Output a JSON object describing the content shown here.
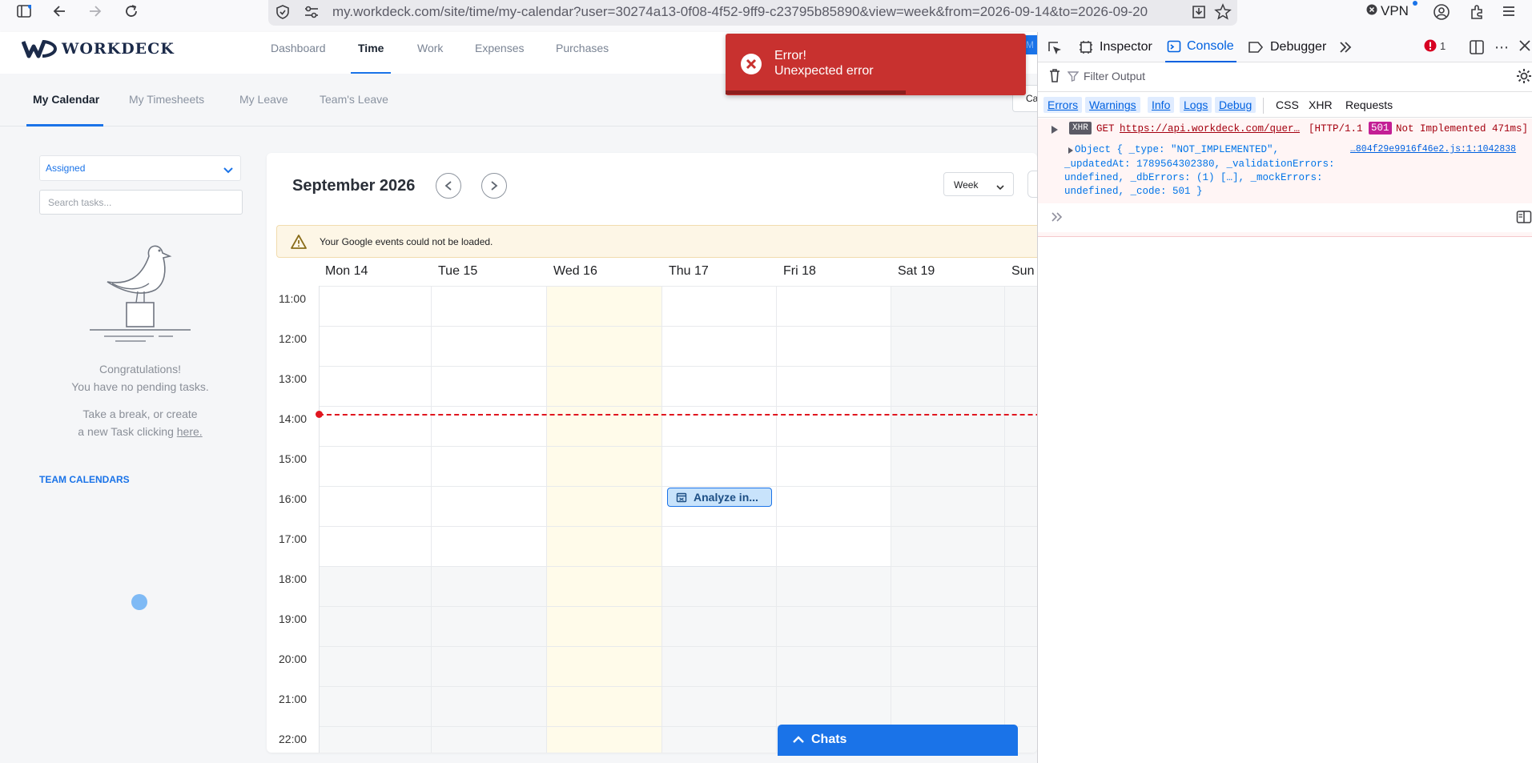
{
  "browser": {
    "url": "my.workdeck.com/site/time/my-calendar?user=30274a13-0f08-4f52-9ff9-c23795b85890&view=week&from=2026-09-14&to=2026-09-20",
    "vpn_label": "VPN"
  },
  "app": {
    "logo_text": "WORKDECK",
    "nav": [
      "Dashboard",
      "Time",
      "Work",
      "Expenses",
      "Purchases"
    ],
    "active_nav": "Time",
    "subtabs": [
      "My Calendar",
      "My Timesheets",
      "My Leave",
      "Team's Leave"
    ],
    "active_subtab": "My Calendar",
    "partial_button_text": "Ca",
    "partial_avatar_text": "M"
  },
  "sidebar": {
    "filter_value": "Assigned",
    "search_placeholder": "Search tasks...",
    "empty_line1": "Congratulations!",
    "empty_line2": "You have no pending tasks.",
    "empty_line3": "Take a break, or create",
    "empty_line4": "a new Task clicking",
    "empty_link": "here.",
    "team_calendars": "TEAM CALENDARS"
  },
  "calendar": {
    "month_title": "September 2026",
    "view": "Week",
    "warning": "Your Google events could not be loaded.",
    "days": [
      "Mon 14",
      "Tue 15",
      "Wed 16",
      "Thu 17",
      "Fri 18",
      "Sat 19",
      "Sun"
    ],
    "today_index": 2,
    "hours": [
      "11:00",
      "12:00",
      "13:00",
      "14:00",
      "15:00",
      "16:00",
      "17:00",
      "18:00",
      "19:00",
      "20:00",
      "21:00",
      "22:00"
    ],
    "now_line_hour": "14:00",
    "event": {
      "title": "Analyze in...",
      "day_index": 3,
      "hour": "16:00"
    }
  },
  "toast": {
    "title": "Error!",
    "message": "Unexpected error"
  },
  "chats_label": "Chats",
  "devtools": {
    "tabs": [
      "Inspector",
      "Console",
      "Debugger"
    ],
    "active_tab": "Console",
    "error_count": "1",
    "filter_placeholder": "Filter Output",
    "filters": [
      "Errors",
      "Warnings",
      "Info",
      "Logs",
      "Debug",
      "CSS",
      "XHR",
      "Requests"
    ],
    "log": {
      "badge": "XHR",
      "method": "GET",
      "url": "https://api.workdeck.com/quer…",
      "status_prefix": "[HTTP/1.1",
      "status_code": "501",
      "status_suffix": "Not Implemented 471ms]",
      "object_line1": "Object { _type: \"NOT_IMPLEMENTED\",",
      "source": "…804f29e9916f46e2.js:1:1042838",
      "object_line2": "_updatedAt: 1789564302380, _validationErrors:",
      "object_line3": "undefined, _dbErrors: (1) […], _mockErrors:",
      "object_line4": "undefined, _code: 501 }"
    }
  }
}
